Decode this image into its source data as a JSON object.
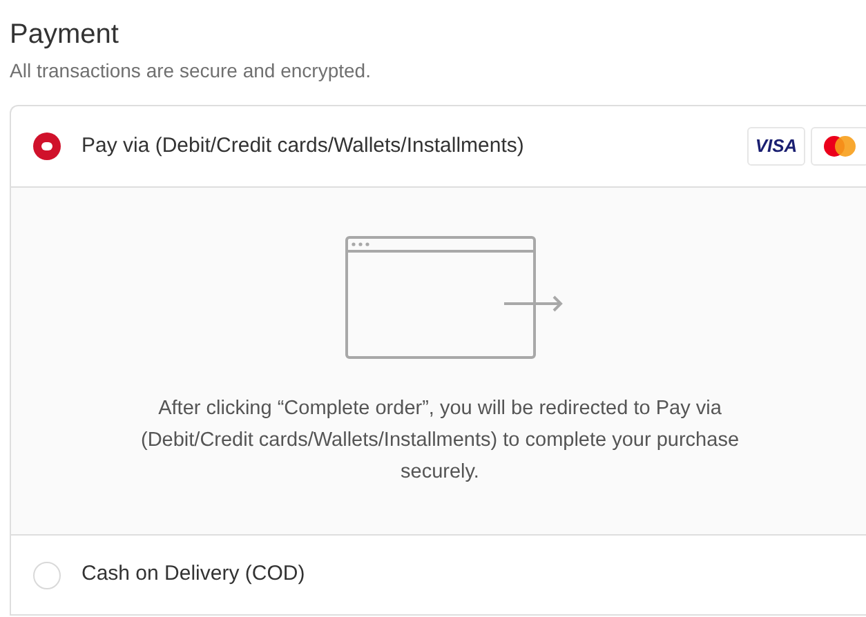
{
  "title": "Payment",
  "subtitle": "All transactions are secure and encrypted.",
  "methods": [
    {
      "label": "Pay via (Debit/Credit cards/Wallets/Installments)",
      "selected": true,
      "badges": [
        {
          "kind": "visa",
          "text": "VISA"
        },
        {
          "kind": "mastercard"
        }
      ],
      "detail": "After clicking “Complete order”, you will be redirected to Pay via (Debit/Credit cards/Wallets/Installments) to complete your purchase securely."
    },
    {
      "label": "Cash on Delivery (COD)",
      "selected": false
    }
  ]
}
